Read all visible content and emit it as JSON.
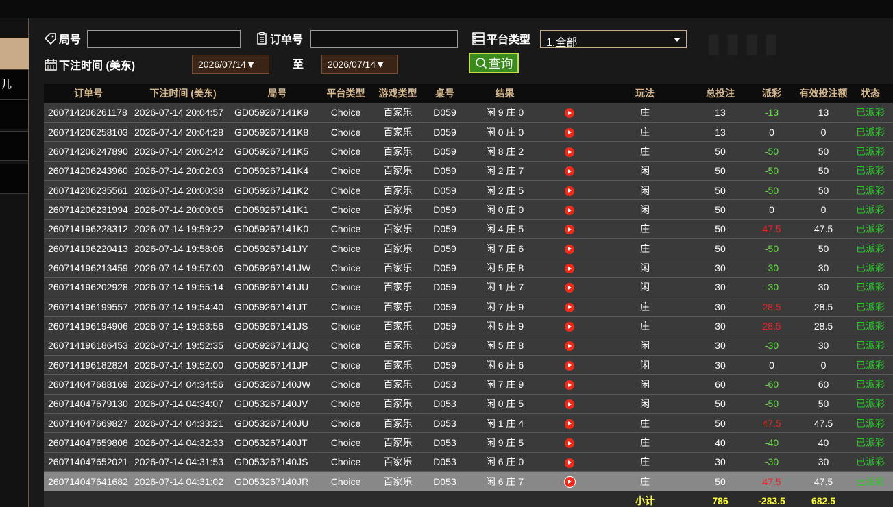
{
  "side": {
    "item_glyph": "儿"
  },
  "filters": {
    "game_no_label": "局号",
    "order_no_label": "订单号",
    "platform_label": "平台类型",
    "platform_selected": "1.全部",
    "bet_time_label": "下注时间 (美东)",
    "date_from": "2026/07/14▼",
    "to_label": "至",
    "date_to": "2026/07/14▼",
    "query_label": "查询"
  },
  "table": {
    "headers": [
      "订单号",
      "下注时间 (美东)",
      "局号",
      "平台类型",
      "游戏类型",
      "桌号",
      "结果",
      "",
      "玩法",
      "总投注",
      "派彩",
      "有效投注额",
      "状态"
    ],
    "rows": [
      [
        "260714206261178",
        "2026-07-14 20:04:57",
        "GD059267141K9",
        "Choice",
        "百家乐",
        "D059",
        "闲 9 庄 0",
        "庄",
        "13",
        "-13",
        "13",
        "已派彩"
      ],
      [
        "260714206258103",
        "2026-07-14 20:04:28",
        "GD059267141K8",
        "Choice",
        "百家乐",
        "D059",
        "闲 0 庄 0",
        "庄",
        "13",
        "0",
        "0",
        "已派彩"
      ],
      [
        "260714206247890",
        "2026-07-14 20:02:42",
        "GD059267141K5",
        "Choice",
        "百家乐",
        "D059",
        "闲 8 庄 2",
        "庄",
        "50",
        "-50",
        "50",
        "已派彩"
      ],
      [
        "260714206243960",
        "2026-07-14 20:02:03",
        "GD059267141K4",
        "Choice",
        "百家乐",
        "D059",
        "闲 2 庄 7",
        "闲",
        "50",
        "-50",
        "50",
        "已派彩"
      ],
      [
        "260714206235561",
        "2026-07-14 20:00:38",
        "GD059267141K2",
        "Choice",
        "百家乐",
        "D059",
        "闲 2 庄 5",
        "闲",
        "50",
        "-50",
        "50",
        "已派彩"
      ],
      [
        "260714206231994",
        "2026-07-14 20:00:05",
        "GD059267141K1",
        "Choice",
        "百家乐",
        "D059",
        "闲 0 庄 0",
        "闲",
        "50",
        "0",
        "0",
        "已派彩"
      ],
      [
        "260714196228312",
        "2026-07-14 19:59:22",
        "GD059267141K0",
        "Choice",
        "百家乐",
        "D059",
        "闲 4 庄 5",
        "庄",
        "50",
        "47.5",
        "47.5",
        "已派彩"
      ],
      [
        "260714196220413",
        "2026-07-14 19:58:06",
        "GD059267141JY",
        "Choice",
        "百家乐",
        "D059",
        "闲 7 庄 6",
        "庄",
        "50",
        "-50",
        "50",
        "已派彩"
      ],
      [
        "260714196213459",
        "2026-07-14 19:57:00",
        "GD059267141JW",
        "Choice",
        "百家乐",
        "D059",
        "闲 5 庄 8",
        "闲",
        "30",
        "-30",
        "30",
        "已派彩"
      ],
      [
        "260714196202928",
        "2026-07-14 19:55:14",
        "GD059267141JU",
        "Choice",
        "百家乐",
        "D059",
        "闲 1 庄 7",
        "闲",
        "30",
        "-30",
        "30",
        "已派彩"
      ],
      [
        "260714196199557",
        "2026-07-14 19:54:40",
        "GD059267141JT",
        "Choice",
        "百家乐",
        "D059",
        "闲 7 庄 9",
        "庄",
        "30",
        "28.5",
        "28.5",
        "已派彩"
      ],
      [
        "260714196194906",
        "2026-07-14 19:53:56",
        "GD059267141JS",
        "Choice",
        "百家乐",
        "D059",
        "闲 5 庄 9",
        "庄",
        "30",
        "28.5",
        "28.5",
        "已派彩"
      ],
      [
        "260714196186453",
        "2026-07-14 19:52:35",
        "GD059267141JQ",
        "Choice",
        "百家乐",
        "D059",
        "闲 5 庄 8",
        "闲",
        "30",
        "-30",
        "30",
        "已派彩"
      ],
      [
        "260714196182824",
        "2026-07-14 19:52:00",
        "GD059267141JP",
        "Choice",
        "百家乐",
        "D059",
        "闲 6 庄 6",
        "闲",
        "30",
        "0",
        "0",
        "已派彩"
      ],
      [
        "260714047688169",
        "2026-07-14 04:34:56",
        "GD053267140JW",
        "Choice",
        "百家乐",
        "D053",
        "闲 7 庄 9",
        "闲",
        "60",
        "-60",
        "60",
        "已派彩"
      ],
      [
        "260714047679130",
        "2026-07-14 04:34:07",
        "GD053267140JV",
        "Choice",
        "百家乐",
        "D053",
        "闲 0 庄 5",
        "闲",
        "50",
        "-50",
        "50",
        "已派彩"
      ],
      [
        "260714047669827",
        "2026-07-14 04:33:21",
        "GD053267140JU",
        "Choice",
        "百家乐",
        "D053",
        "闲 1 庄 4",
        "庄",
        "50",
        "47.5",
        "47.5",
        "已派彩"
      ],
      [
        "260714047659808",
        "2026-07-14 04:32:33",
        "GD053267140JT",
        "Choice",
        "百家乐",
        "D053",
        "闲 9 庄 5",
        "庄",
        "40",
        "-40",
        "40",
        "已派彩"
      ],
      [
        "260714047652021",
        "2026-07-14 04:31:53",
        "GD053267140JS",
        "Choice",
        "百家乐",
        "D053",
        "闲 6 庄 0",
        "庄",
        "30",
        "-30",
        "30",
        "已派彩"
      ],
      [
        "260714047641682",
        "2026-07-14 04:31:02",
        "GD053267140JR",
        "Choice",
        "百家乐",
        "D053",
        "闲 6 庄 7",
        "庄",
        "50",
        "47.5",
        "47.5",
        "已派彩"
      ]
    ],
    "highlighted_row": 19,
    "subtotal": {
      "label": "小计",
      "total_bet": "786",
      "payout": "-283.5",
      "valid_bet": "682.5"
    }
  },
  "colors": {
    "accent": "#c9ab87",
    "header_text": "#d5b78e",
    "payout_negative": "#66dd44",
    "payout_positive": "#ee2222",
    "status": "#22cc22",
    "subtotal": "#ffff33"
  }
}
